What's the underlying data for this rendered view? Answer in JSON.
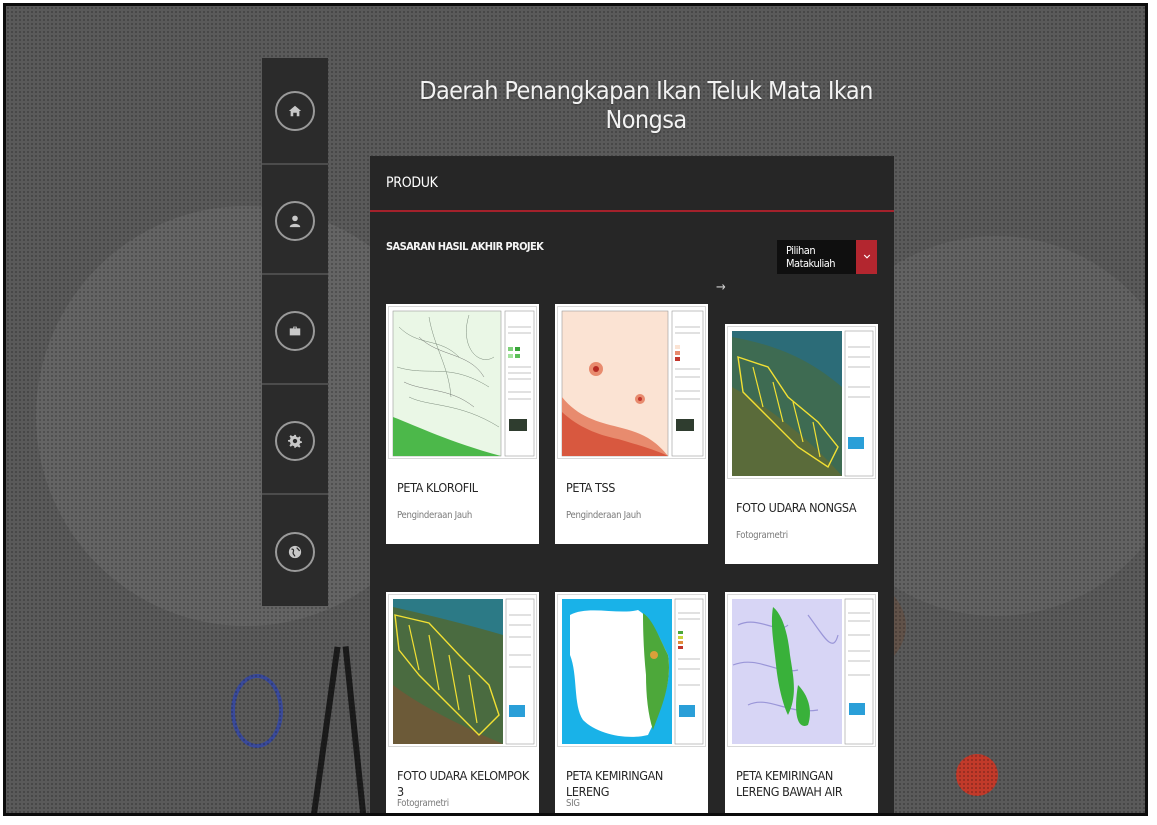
{
  "page": {
    "title": "Daerah Penangkapan Ikan Teluk Mata Ikan Nongsa"
  },
  "sidebar": {
    "items": [
      {
        "icon": "home-icon",
        "name": "sidebar-item-home"
      },
      {
        "icon": "user-icon",
        "name": "sidebar-item-profile"
      },
      {
        "icon": "briefcase-icon",
        "name": "sidebar-item-portfolio"
      },
      {
        "icon": "gear-icon",
        "name": "sidebar-item-settings"
      },
      {
        "icon": "globe-icon",
        "name": "sidebar-item-contact"
      }
    ]
  },
  "panel": {
    "header": "PRODUK",
    "subtitle": "SASARAN HASIL AKHIR PROJEK",
    "dropdown_label": "Pilihan Matakuliah",
    "arrow_hint": "→"
  },
  "cards": [
    {
      "title": "PETA KLOROFIL",
      "subtitle": "Penginderaan Jauh",
      "map": "chlorophyll"
    },
    {
      "title": "PETA TSS",
      "subtitle": "Penginderaan Jauh",
      "map": "tss"
    },
    {
      "title": "FOTO UDARA NONGSA",
      "subtitle": "Fotogrametri",
      "map": "aerial"
    },
    {
      "title": "FOTO UDARA KELOMPOK 3",
      "subtitle": "Fotogrametri",
      "map": "aerial2"
    },
    {
      "title": "PETA KEMIRINGAN LERENG",
      "subtitle": "SIG",
      "map": "slope"
    },
    {
      "title": "PETA KEMIRINGAN LERENG BAWAH AIR",
      "subtitle": "",
      "map": "underwater"
    }
  ],
  "colors": {
    "accent": "#b3262f",
    "panel_bg": "#262626",
    "sidebar_bg": "#2b2b2b"
  }
}
